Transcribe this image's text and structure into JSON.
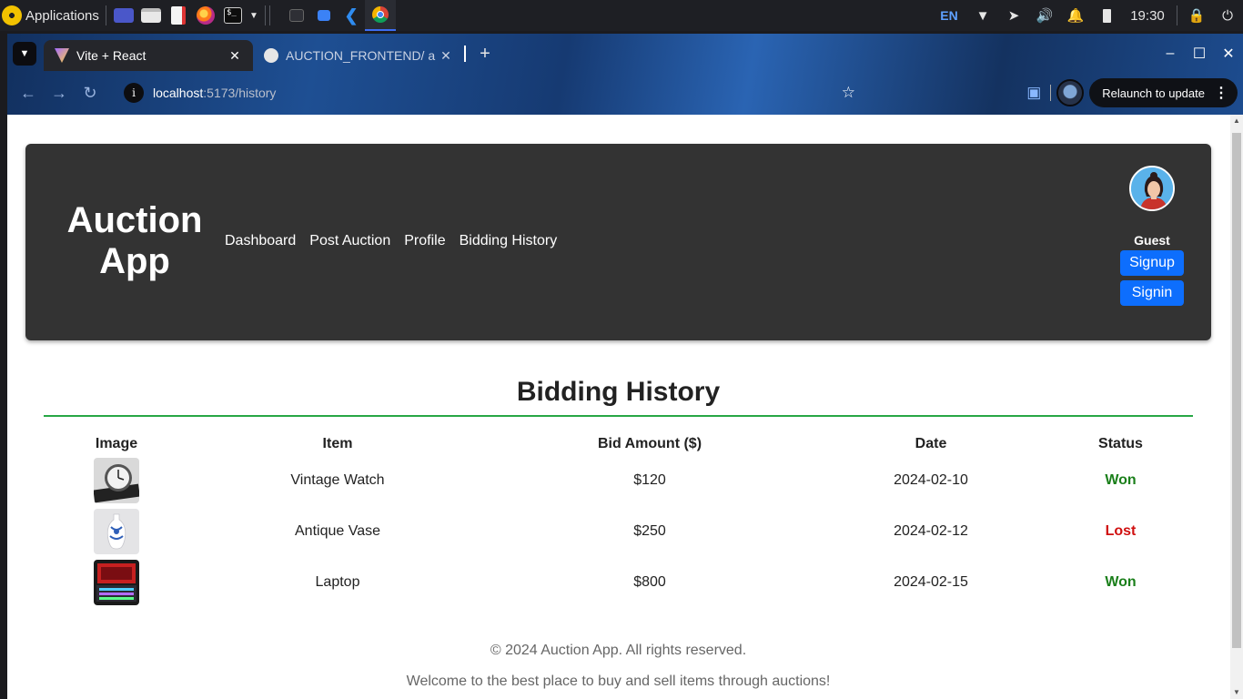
{
  "taskbar": {
    "apps_label": "Applications",
    "lang": "EN",
    "clock": "19:30"
  },
  "browser": {
    "tabs": [
      {
        "title": "Vite + React",
        "active": true
      },
      {
        "title": "AUCTION_FRONTEND/ a",
        "active": false
      }
    ],
    "new_tab": "+",
    "url_host": "localhost",
    "url_path": ":5173/history",
    "relaunch_label": "Relaunch to update"
  },
  "header": {
    "brand_line1": "Auction",
    "brand_line2": "App",
    "nav": [
      "Dashboard",
      "Post Auction",
      "Profile",
      "Bidding History"
    ],
    "user_label": "Guest",
    "signup_label": "Signup",
    "signin_label": "Signin"
  },
  "history": {
    "title": "Bidding History",
    "columns": [
      "Image",
      "Item",
      "Bid Amount ($)",
      "Date",
      "Status"
    ],
    "rows": [
      {
        "image": "watch-image",
        "item": "Vintage Watch",
        "amount": "$120",
        "date": "2024-02-10",
        "status": "Won"
      },
      {
        "image": "vase-image",
        "item": "Antique Vase",
        "amount": "$250",
        "date": "2024-02-12",
        "status": "Lost"
      },
      {
        "image": "laptop-image",
        "item": "Laptop",
        "amount": "$800",
        "date": "2024-02-15",
        "status": "Won"
      }
    ],
    "status_colors": {
      "Won": "#1a7f1a",
      "Lost": "#d01010"
    }
  },
  "footer": {
    "copyright": "© 2024 Auction App. All rights reserved.",
    "tagline": "Welcome to the best place to buy and sell items through auctions!"
  }
}
